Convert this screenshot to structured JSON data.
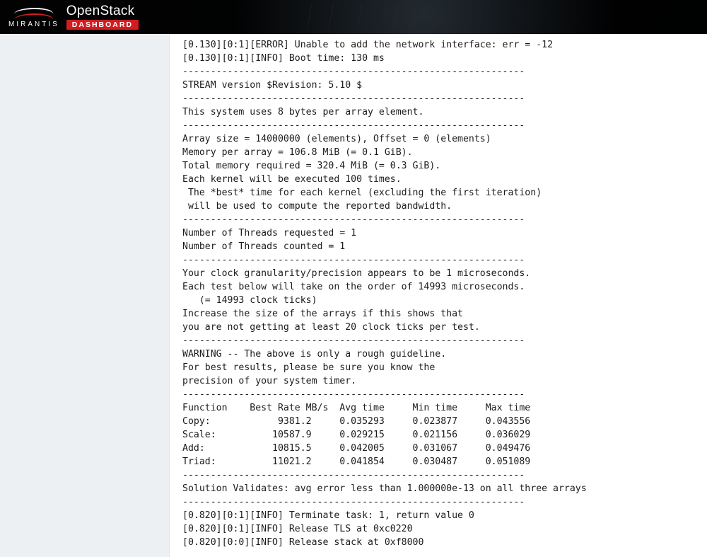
{
  "header": {
    "brand": "MIRANTIS",
    "product": "OpenStack",
    "badge": "DASHBOARD"
  },
  "log": {
    "lines": [
      "[0.130][0:1][ERROR] Unable to add the network interface: err = -12",
      "[0.130][0:1][INFO] Boot time: 130 ms",
      "-------------------------------------------------------------",
      "STREAM version $Revision: 5.10 $",
      "-------------------------------------------------------------",
      "This system uses 8 bytes per array element.",
      "-------------------------------------------------------------",
      "Array size = 14000000 (elements), Offset = 0 (elements)",
      "Memory per array = 106.8 MiB (= 0.1 GiB).",
      "Total memory required = 320.4 MiB (= 0.3 GiB).",
      "Each kernel will be executed 100 times.",
      " The *best* time for each kernel (excluding the first iteration)",
      " will be used to compute the reported bandwidth.",
      "-------------------------------------------------------------",
      "Number of Threads requested = 1",
      "Number of Threads counted = 1",
      "-------------------------------------------------------------",
      "Your clock granularity/precision appears to be 1 microseconds.",
      "Each test below will take on the order of 14993 microseconds.",
      "   (= 14993 clock ticks)",
      "Increase the size of the arrays if this shows that",
      "you are not getting at least 20 clock ticks per test.",
      "-------------------------------------------------------------",
      "WARNING -- The above is only a rough guideline.",
      "For best results, please be sure you know the",
      "precision of your system timer.",
      "-------------------------------------------------------------",
      "Function    Best Rate MB/s  Avg time     Min time     Max time",
      "Copy:            9381.2     0.035293     0.023877     0.043556",
      "Scale:          10587.9     0.029215     0.021156     0.036029",
      "Add:            10815.5     0.042005     0.031067     0.049476",
      "Triad:          11021.2     0.041854     0.030487     0.051089",
      "-------------------------------------------------------------",
      "Solution Validates: avg error less than 1.000000e-13 on all three arrays",
      "-------------------------------------------------------------",
      "[0.820][0:1][INFO] Terminate task: 1, return value 0",
      "[0.820][0:1][INFO] Release TLS at 0xc0220",
      "[0.820][0:0][INFO] Release stack at 0xf8000"
    ]
  }
}
